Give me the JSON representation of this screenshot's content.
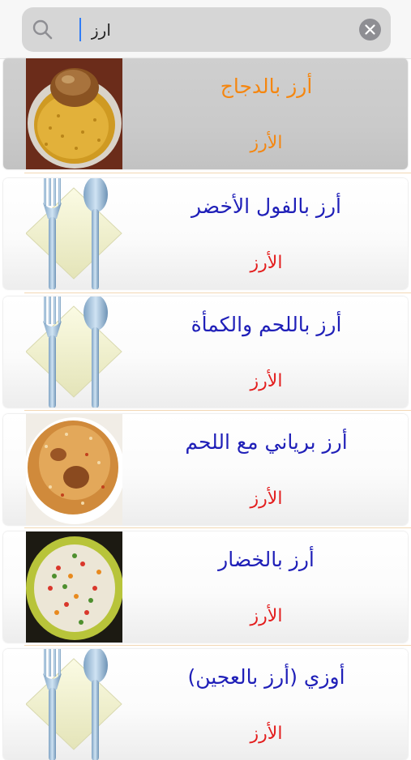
{
  "search": {
    "value": "ارز",
    "icon": "search-icon",
    "clear_icon": "clear-icon"
  },
  "colors": {
    "title": "#1f1fb8",
    "category": "#e31d1d",
    "selected_text": "#f5860f",
    "caret": "#2f7cf6"
  },
  "items": [
    {
      "title": "أرز بالدجاج",
      "category": "الأرز",
      "image": "chicken-rice-photo",
      "selected": true
    },
    {
      "title": "أرز بالفول الأخضر",
      "category": "الأرز",
      "image": "fork-spoon-placeholder",
      "selected": false
    },
    {
      "title": "أرز باللحم والكمأة",
      "category": "الأرز",
      "image": "fork-spoon-placeholder",
      "selected": false
    },
    {
      "title": "أرز برياني مع اللحم",
      "category": "الأرز",
      "image": "biryani-photo",
      "selected": false
    },
    {
      "title": "أرز بالخضار",
      "category": "الأرز",
      "image": "vegetable-rice-photo",
      "selected": false
    },
    {
      "title": "أوزي (أرز بالعجين)",
      "category": "الأرز",
      "image": "fork-spoon-placeholder",
      "selected": false
    }
  ]
}
